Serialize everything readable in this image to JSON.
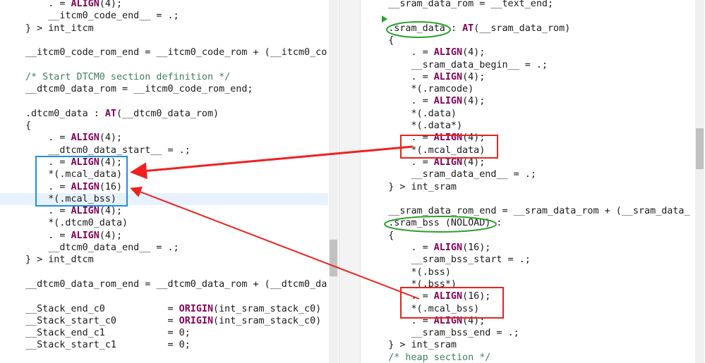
{
  "left_editor": {
    "lines": [
      {
        "pre": "    . = ",
        "kw": "ALIGN",
        "post": "(4);"
      },
      {
        "pre": "    __itcm0_code_end__ = .;"
      },
      {
        "pre": "} > int_itcm"
      },
      {
        "pre": ""
      },
      {
        "pre": "__itcm0_code_rom_end = __itcm0_code_rom + (__itcm0_co"
      },
      {
        "pre": ""
      },
      {
        "cm": "/* Start DTCM0 section definition */"
      },
      {
        "pre": "__dtcm0_data_rom = __itcm0_code_rom_end;"
      },
      {
        "pre": ""
      },
      {
        "pre": ".dtcm0_data : ",
        "kw": "AT",
        "post": "(__dtcm0_data_rom)"
      },
      {
        "pre": "{"
      },
      {
        "pre": "    . = ",
        "kw": "ALIGN",
        "post": "(4);"
      },
      {
        "pre": "    __dtcm0_data_start__ = .;"
      },
      {
        "pre": "    . = ",
        "kw": "ALIGN",
        "post": "(4);"
      },
      {
        "pre": "    *(.mcal_data)"
      },
      {
        "pre": "    . = ",
        "kw": "ALIGN",
        "post": "(16)"
      },
      {
        "pre": "    *(.mcal_bss)"
      },
      {
        "pre": "    . = ",
        "kw": "ALIGN",
        "post": "(4);"
      },
      {
        "pre": "    *(.dtcm0_data)"
      },
      {
        "pre": "    . = ",
        "kw": "ALIGN",
        "post": "(4);"
      },
      {
        "pre": "    __dtcm0_data_end__ = .;"
      },
      {
        "pre": "} > int_dtcm"
      },
      {
        "pre": ""
      },
      {
        "pre": "__dtcm0_data_rom_end = __dtcm0_data_rom + (__dtcm0_da"
      },
      {
        "pre": ""
      },
      {
        "pre": "__Stack_end_c0           = ",
        "kw": "ORIGIN",
        "post": "(int_sram_stack_c0)"
      },
      {
        "pre": "__Stack_start_c0         = ",
        "kw": "ORIGIN",
        "post": "(int_sram_stack_c0)"
      },
      {
        "pre": "__Stack_end_c1           = 0;"
      },
      {
        "pre": "__Stack_start_c1         = 0;"
      }
    ]
  },
  "right_editor": {
    "lines": [
      {
        "pre": "    __sram_data_rom = __text_end;"
      },
      {
        "pre": ""
      },
      {
        "pre": "    .sram_data : ",
        "kw": "AT",
        "post": "(__sram_data_rom)"
      },
      {
        "pre": "    {"
      },
      {
        "pre": "        . = ",
        "kw": "ALIGN",
        "post": "(4);"
      },
      {
        "pre": "        __sram_data_begin__ = .;"
      },
      {
        "pre": "        . = ",
        "kw": "ALIGN",
        "post": "(4);"
      },
      {
        "pre": "        *(.ramcode)"
      },
      {
        "pre": "        . = ",
        "kw": "ALIGN",
        "post": "(4);"
      },
      {
        "pre": "        *(.data)"
      },
      {
        "pre": "        *(.data*)"
      },
      {
        "pre": "        . = ",
        "kw": "ALIGN",
        "post": "(4);"
      },
      {
        "pre": "        *(.mcal_data)"
      },
      {
        "pre": "        . = ",
        "kw": "ALIGN",
        "post": "(4);"
      },
      {
        "pre": "        __sram_data_end__ = .;"
      },
      {
        "pre": "    } > int_sram"
      },
      {
        "pre": ""
      },
      {
        "pre": "    __sram_data_rom_end = __sram_data_rom + (__sram_data_"
      },
      {
        "pre": "    .sram_bss (NOLOAD) :"
      },
      {
        "pre": "    {"
      },
      {
        "pre": "        . = ",
        "kw": "ALIGN",
        "post": "(16);"
      },
      {
        "pre": "        __sram_bss_start = .;"
      },
      {
        "pre": "        *(.bss)"
      },
      {
        "pre": "        *(.bss*)"
      },
      {
        "pre": "        . = ",
        "kw": "ALIGN",
        "post": "(16);"
      },
      {
        "pre": "        *(.mcal_bss)"
      },
      {
        "pre": "        . = ",
        "kw": "ALIGN",
        "post": "(4);"
      },
      {
        "pre": "        __sram_bss_end = .;"
      },
      {
        "pre": "    } > int_sram"
      },
      {
        "cm": "    /* heap section */"
      }
    ]
  },
  "colors": {
    "keyword": "#7f0055",
    "comment": "#3f7f5f",
    "line_highlight": "#e8f2fe",
    "blue_box": "#1e8fe0",
    "red_box": "#e8231e",
    "green_ellipse": "#2aa02a",
    "arrow": "#f02020"
  },
  "icons": [
    "green-caret-icon"
  ]
}
